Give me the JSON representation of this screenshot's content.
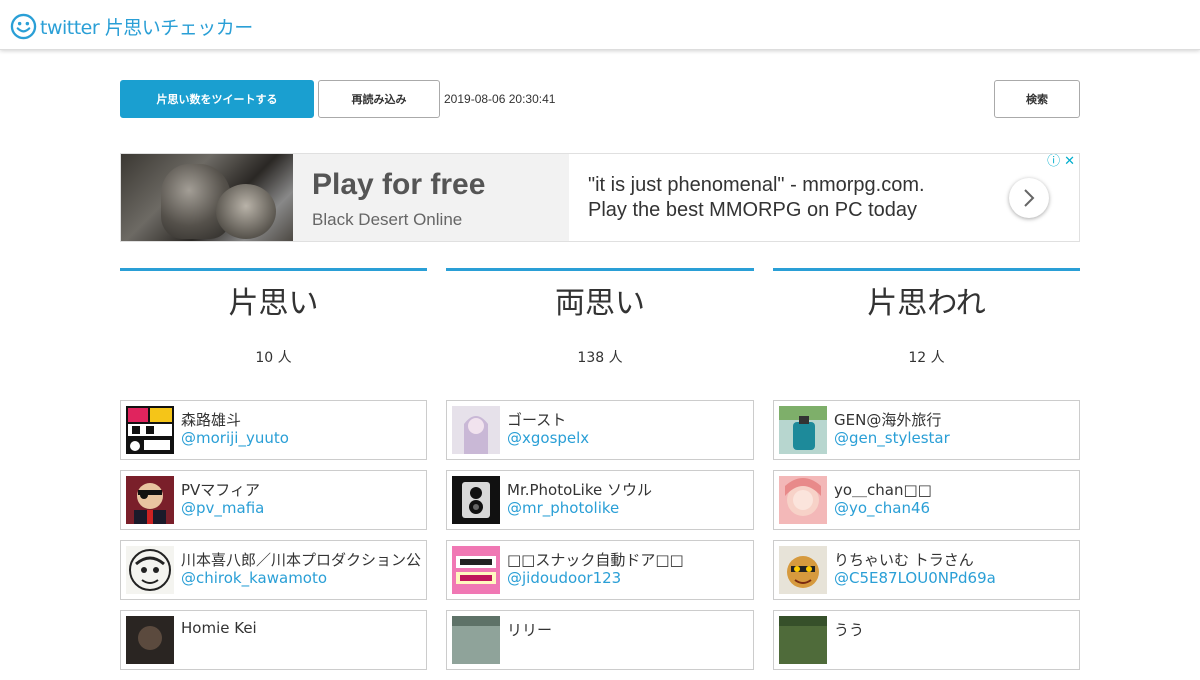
{
  "header": {
    "logo_icon": "smiley-icon",
    "title": "twitter 片思いチェッカー",
    "brand_color": "#2a9fd6"
  },
  "toolbar": {
    "tweet_label": "片思い数をツイートする",
    "reload_label": "再読み込み",
    "timestamp": "2019-08-06 20:30:41",
    "search_label": "検索",
    "accent_color": "#1a9fd0"
  },
  "ad": {
    "headline": "Play for free",
    "sub": "Black Desert Online",
    "copy_line1": "\"it is just phenomenal\" - mmorpg.com.",
    "copy_line2": "Play the best MMORPG on PC today",
    "info_icon": "ⓘ",
    "close_icon": "✕"
  },
  "columns": [
    {
      "title": "片思い",
      "count": "10 人",
      "users": [
        {
          "name": "森路雄斗",
          "handle": "@moriji_yuuto",
          "avatar": "manga-avatar"
        },
        {
          "name": "PVマフィア",
          "handle": "@pv_mafia",
          "avatar": "pirate-avatar"
        },
        {
          "name": "川本喜八郎／川本プロダクション公",
          "handle": "@chirok_kawamoto",
          "avatar": "sketch-avatar"
        },
        {
          "name": "Homie Kei",
          "handle": "",
          "avatar": "dark-avatar"
        }
      ]
    },
    {
      "title": "両思い",
      "count": "138 人",
      "users": [
        {
          "name": "ゴースト",
          "handle": "@xgospelx",
          "avatar": "ghost-avatar"
        },
        {
          "name": "Mr.PhotoLike ソウル",
          "handle": "@mr_photolike",
          "avatar": "camera-avatar"
        },
        {
          "name": "□□スナック自動ドア□□",
          "handle": "@jidoudoor123",
          "avatar": "snack-avatar"
        },
        {
          "name": "リリー",
          "handle": "",
          "avatar": "lily-avatar"
        }
      ]
    },
    {
      "title": "片思われ",
      "count": "12 人",
      "users": [
        {
          "name": "GEN@海外旅行",
          "handle": "@gen_stylestar",
          "avatar": "travel-avatar"
        },
        {
          "name": "yo＿chan□□",
          "handle": "@yo_chan46",
          "avatar": "pink-avatar"
        },
        {
          "name": "りちゃいむ トラさん",
          "handle": "@C5E87LOU0NPd69a",
          "avatar": "tiger-avatar"
        },
        {
          "name": "うう",
          "handle": "",
          "avatar": "green-avatar"
        }
      ]
    }
  ]
}
